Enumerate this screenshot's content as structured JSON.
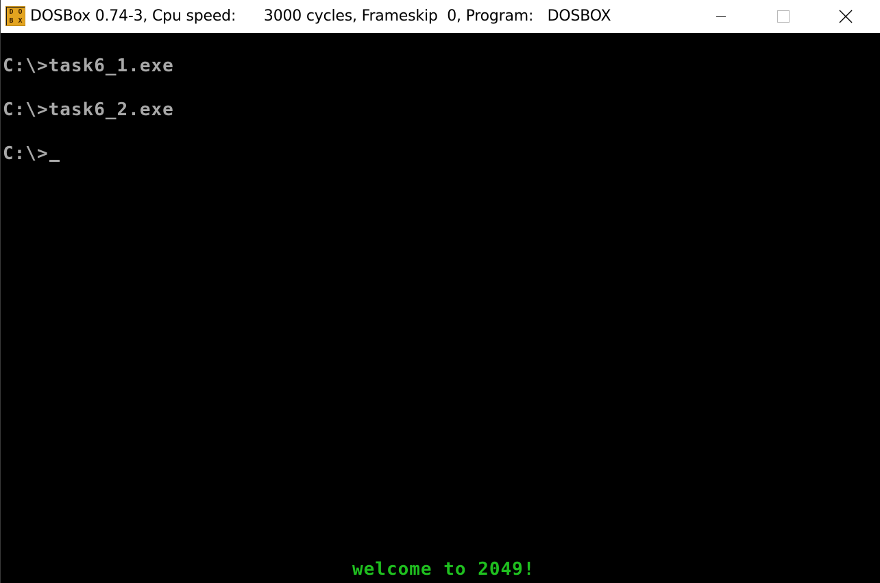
{
  "window": {
    "title": "DOSBox 0.74-3, Cpu speed:      3000 cycles, Frameskip  0, Program:   DOSBOX",
    "icon": "dosbox-icon",
    "icon_text": [
      "DOS",
      "BOX"
    ],
    "controls": {
      "minimize": "minimize-icon",
      "maximize": "maximize-icon",
      "close": "close-icon"
    }
  },
  "console": {
    "lines": [
      "C:\\>task6_1.exe",
      "C:\\>task6_2.exe",
      "C:\\>"
    ],
    "status_message": "welcome to 2049!",
    "colors": {
      "background": "#000000",
      "text": "#a8a8a8",
      "status": "#1fbf1f"
    }
  }
}
